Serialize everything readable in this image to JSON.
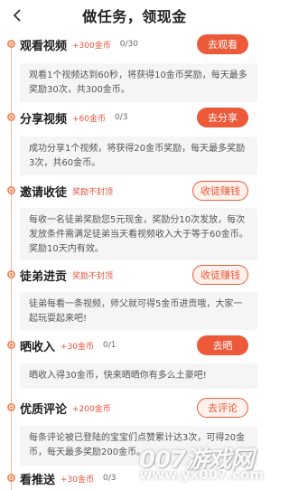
{
  "header": {
    "title": "做任务，领现金",
    "back_icon": "chevron-left-icon"
  },
  "colors": {
    "accent": "#ec5a39",
    "timeline": "#f08a5d",
    "desc_bg": "#f5f5f5"
  },
  "tasks": [
    {
      "title": "观看视频",
      "reward": "+300金币",
      "progress": "0/30",
      "button": "去观看",
      "button_style": "filled",
      "description": "观看1个视频达到60秒，将获得10金币奖励，每天最多奖励30次，共300金币。"
    },
    {
      "title": "分享视频",
      "reward": "+60金币",
      "progress": "0/3",
      "button": "去分享",
      "button_style": "filled",
      "description": "成功分享1个视频，将获得20金币奖励，每天最多奖励3次，共60金币。"
    },
    {
      "title": "邀请收徒",
      "reward": "奖励不封顶",
      "progress": "",
      "button": "收徒赚钱",
      "button_style": "outline",
      "description": "每收一名徒弟奖励您5元现金，奖励分10次发放，每次发放条件需满足徒弟当天看视频收入大于等于60金币。奖励10天内有效。"
    },
    {
      "title": "徒弟进贡",
      "reward": "奖励不封顶",
      "progress": "",
      "button": "收徒赚钱",
      "button_style": "outline",
      "description": "徒弟每看一条视频，师父就可得5金币进贡哦，大家一起玩耍起来吧!"
    },
    {
      "title": "晒收入",
      "reward": "+30金币",
      "progress": "0/1",
      "button": "去晒",
      "button_style": "filled",
      "description": "晒收入得30金币，快来晒晒你有多么土豪吧!"
    },
    {
      "title": "优质评论",
      "reward": "+200金币",
      "progress": "",
      "button": "去评论",
      "button_style": "outline",
      "description": "每条评论被已登陆的宝宝们点赞累计达3次，可得20金币，每天最多奖励200金币。"
    },
    {
      "title": "看推送",
      "reward": "+30金币",
      "progress": "0/3",
      "button": "",
      "button_style": "none",
      "description": ""
    }
  ],
  "watermark": {
    "main": "007游戏网",
    "url": "www.yx007.com"
  }
}
